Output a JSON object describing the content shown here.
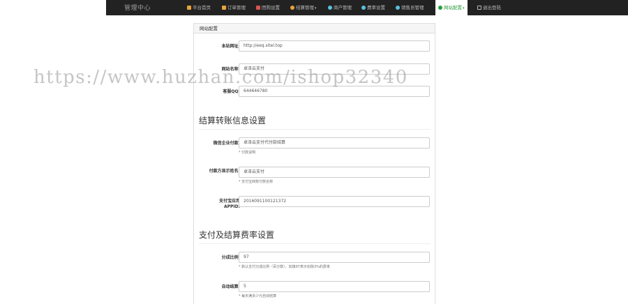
{
  "nav": {
    "brand": "管理中心",
    "items": [
      {
        "label": "平台首页",
        "icon": "home-icon",
        "color": "#e8a33c"
      },
      {
        "label": "订单管理",
        "icon": "cart-icon",
        "color": "#e8a33c"
      },
      {
        "label": "团购设置",
        "icon": "gift-icon",
        "color": "#d9534f"
      },
      {
        "label": "结算管理",
        "icon": "cloud-icon",
        "color": "#e8a33c",
        "caret": "▾"
      },
      {
        "label": "商户管理",
        "icon": "user-icon",
        "color": "#5bc0de"
      },
      {
        "label": "费率设置",
        "icon": "user-icon",
        "color": "#5bc0de"
      },
      {
        "label": "销售员管理",
        "icon": "user-icon",
        "color": "#5bc0de"
      },
      {
        "label": "网站配置",
        "icon": "chat-icon",
        "color": "#2a9d3f",
        "caret": "▾"
      },
      {
        "label": "退出登陆",
        "icon": "logout-icon",
        "color": "#bbbbbb"
      }
    ]
  },
  "panel": {
    "title": "网站配置",
    "fields": {
      "site_url": {
        "label": "本站网址:",
        "value": "http://eeq.sitel.top"
      },
      "site_name": {
        "label": "网站名称:",
        "value": "卓泽云支付"
      },
      "qq": {
        "label": "客服QQ:",
        "value": "644646780"
      }
    },
    "section_transfer": "结算转账信息设置",
    "transfer_fields": {
      "wechat_name": {
        "label": "微信企业付款:",
        "value": "卓泽云支付代付款结算",
        "help": "* 付款说明"
      },
      "payer_name": {
        "label": "付款方显示姓名:",
        "value": "卓泽云支付",
        "help": "* 支付宝转账付款名称"
      },
      "appid": {
        "label": "支付宝应用APPID:",
        "value": "2016091100121372"
      }
    },
    "section_rate": "支付及结算费率设置",
    "rate_fields": {
      "split_rate": {
        "label": "分成比例:",
        "value": "97",
        "help": "* 默认支付分成比例（百分数），如填97表示扣除3%的费率"
      },
      "auto_settle": {
        "label": "自动结算:",
        "value": "5",
        "help": "* 每天满多少元自动结算"
      }
    }
  },
  "watermark": "https://www.huzhan.com/ishop32340"
}
